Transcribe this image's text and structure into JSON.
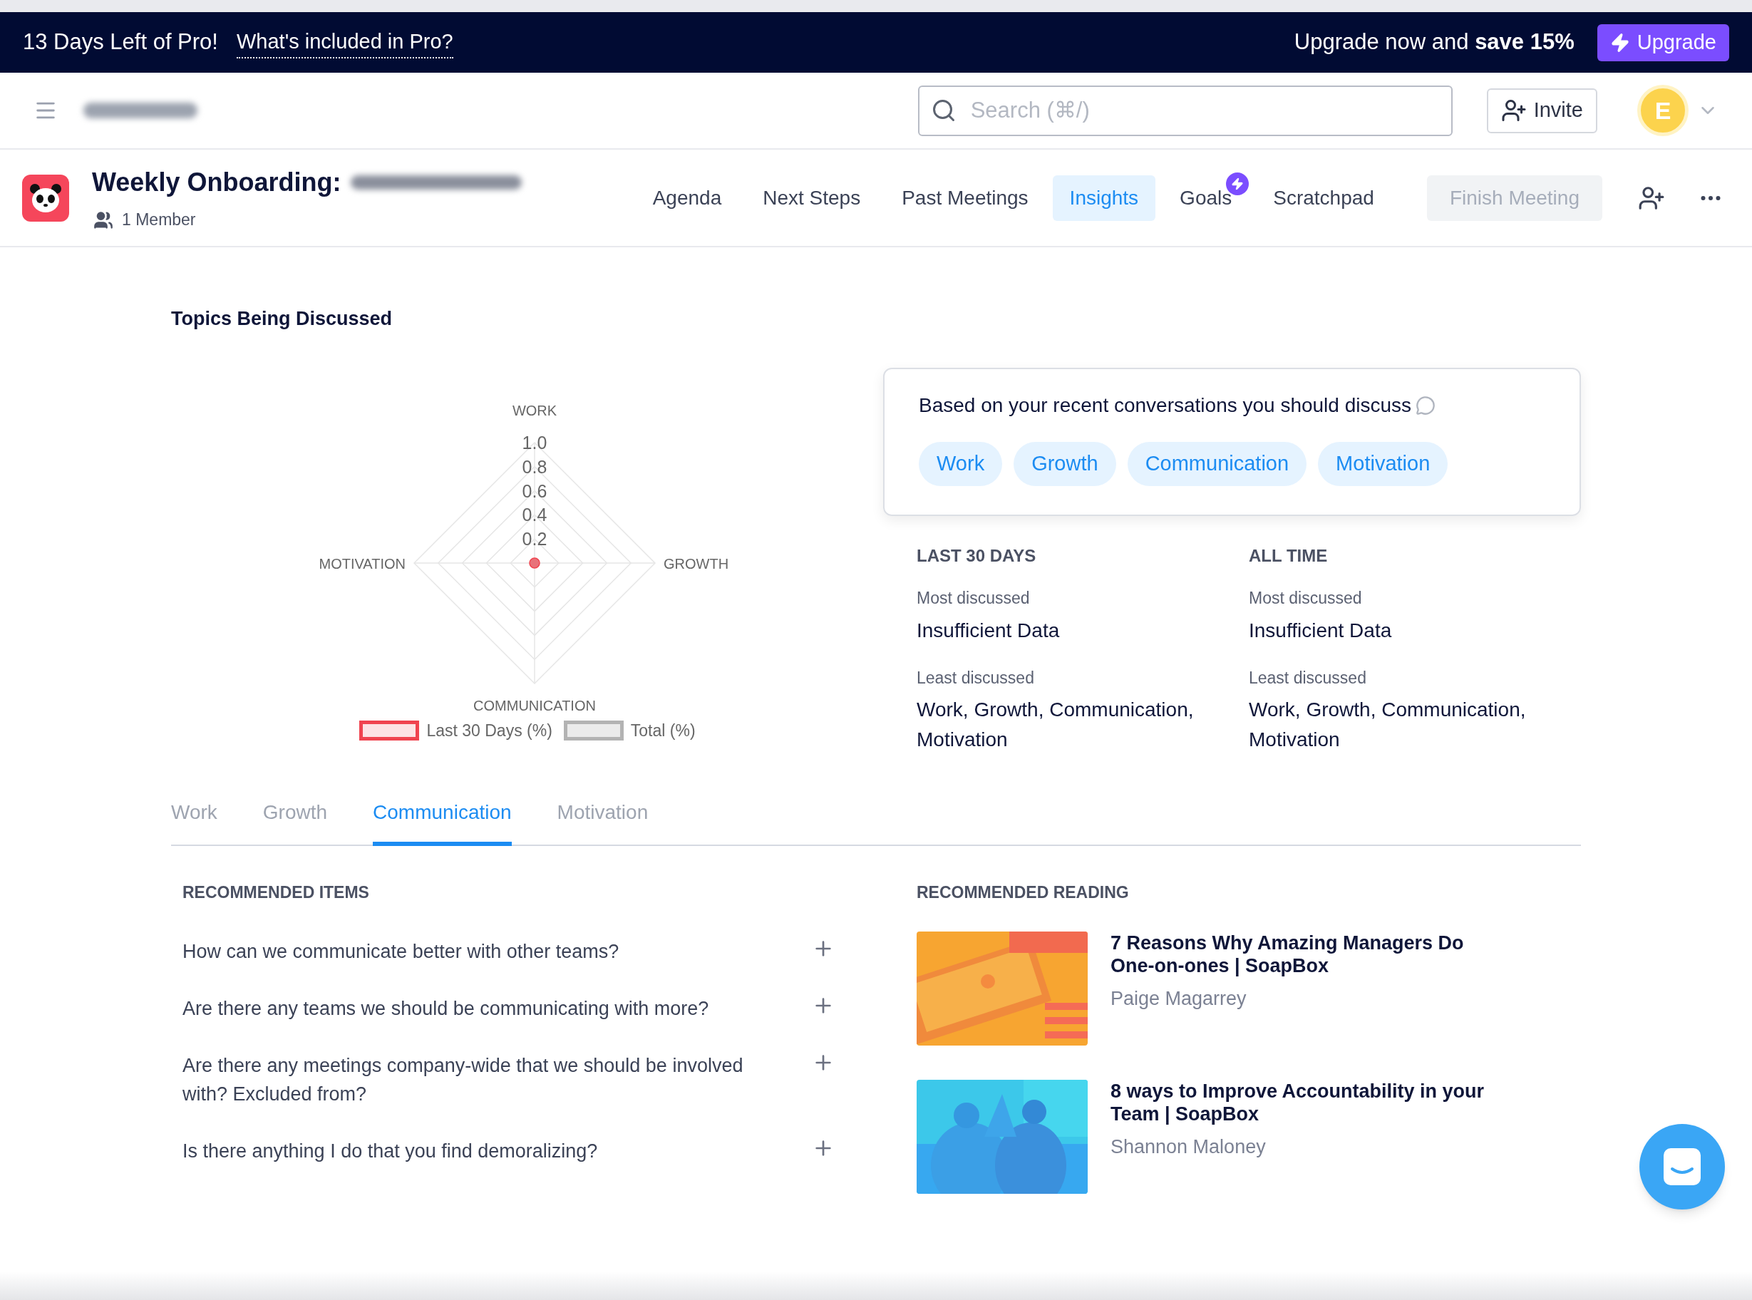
{
  "banner": {
    "days_left": "13 Days Left of Pro!",
    "link": "What's included in Pro?",
    "offer": "Upgrade now and **save 15%**",
    "button": "Upgrade"
  },
  "header": {
    "search_placeholder": "Search (⌘/)",
    "invite": "Invite",
    "avatar_letter": "E"
  },
  "meeting": {
    "title": "Weekly Onboarding:",
    "members": "1 Member",
    "tabs": [
      {
        "label": "Agenda",
        "selected": false,
        "badge": false
      },
      {
        "label": "Next Steps",
        "selected": false,
        "badge": false
      },
      {
        "label": "Past Meetings",
        "selected": false,
        "badge": false
      },
      {
        "label": "Insights",
        "selected": true,
        "badge": false
      },
      {
        "label": "Goals",
        "selected": false,
        "badge": true
      },
      {
        "label": "Scratchpad",
        "selected": false,
        "badge": false
      }
    ],
    "finish_button": {
      "label": "Finish Meeting",
      "disabled": true
    }
  },
  "topics": {
    "title": "Topics Being Discussed",
    "chart": {
      "axes": [
        "WORK",
        "GROWTH",
        "COMMUNICATION",
        "MOTIVATION"
      ],
      "ticks": [
        "1.0",
        "0.8",
        "0.6",
        "0.4",
        "0.2"
      ],
      "legend": [
        {
          "label": "Last 30 Days (%)",
          "color": "#f0434f"
        },
        {
          "label": "Total (%)",
          "color": "#b3b3b3"
        }
      ]
    }
  },
  "suggestion": {
    "text": "Based on your recent conversations you should discuss",
    "tags": [
      "Work",
      "Growth",
      "Communication",
      "Motivation"
    ]
  },
  "stats": [
    {
      "heading": "LAST 30 DAYS",
      "most_label": "Most discussed",
      "most_value": "Insufficient Data",
      "least_label": "Least discussed",
      "least_value": "Work, Growth, Communication, Motivation"
    },
    {
      "heading": "ALL TIME",
      "most_label": "Most discussed",
      "most_value": "Insufficient Data",
      "least_label": "Least discussed",
      "least_value": "Work, Growth, Communication, Motivation"
    }
  ],
  "topic_tabs": [
    {
      "label": "Work",
      "selected": false
    },
    {
      "label": "Growth",
      "selected": false
    },
    {
      "label": "Communication",
      "selected": true
    },
    {
      "label": "Motivation",
      "selected": false
    }
  ],
  "recommended_items": {
    "heading": "RECOMMENDED ITEMS",
    "items": [
      "How can we communicate better with other teams?",
      "Are there any teams we should be communicating with more?",
      "Are there any meetings company-wide that we should be involved with? Excluded from?",
      "Is there anything I do that you find demoralizing?"
    ]
  },
  "recommended_reading": {
    "heading": "RECOMMENDED READING",
    "articles": [
      {
        "title": "7 Reasons Why Amazing Managers Do One-on-ones | SoapBox",
        "author": "Paige Magarrey"
      },
      {
        "title": "8 ways to Improve Accountability in your Team | SoapBox",
        "author": "Shannon Maloney"
      }
    ]
  }
}
